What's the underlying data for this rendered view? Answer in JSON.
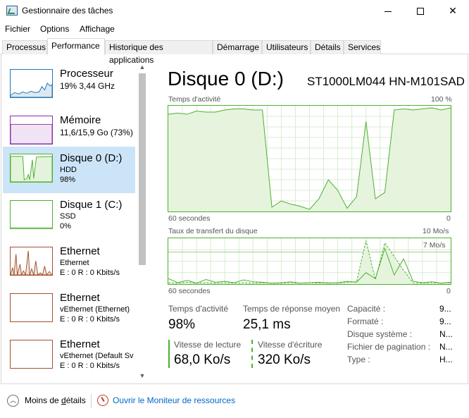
{
  "window": {
    "title": "Gestionnaire des tâches",
    "minimize_glyph": "",
    "maximize_glyph": "",
    "close_glyph": "✕"
  },
  "menu": [
    "Fichier",
    "Options",
    "Affichage"
  ],
  "tabs": [
    "Processus",
    "Performance",
    "Historique des applications",
    "Démarrage",
    "Utilisateurs",
    "Détails",
    "Services"
  ],
  "active_tab": "Performance",
  "sidebar": {
    "items": [
      {
        "name": "Processeur",
        "line1": "19% 3,44 GHz",
        "line2": "",
        "color": "#1f77b4",
        "level": 0.19
      },
      {
        "name": "Mémoire",
        "line1": "11,6/15,9 Go (73%)",
        "line2": "",
        "color": "#8b2fa8",
        "level": 0.73
      },
      {
        "name": "Disque 0 (D:)",
        "line1": "HDD",
        "line2": "98%",
        "color": "#4caf2f",
        "level": 0.98
      },
      {
        "name": "Disque 1 (C:)",
        "line1": "SSD",
        "line2": "0%",
        "color": "#4caf2f",
        "level": 0.0
      },
      {
        "name": "Ethernet",
        "line1": "Ethernet",
        "line2": "E : 0 R : 0 Kbits/s",
        "color": "#a0522d",
        "level": 0.0
      },
      {
        "name": "Ethernet",
        "line1": "vEthernet (Ethernet)",
        "line2": "E : 0 R : 0 Kbits/s",
        "color": "#a0522d",
        "level": 0.0
      },
      {
        "name": "Ethernet",
        "line1": "vEthernet (Default Sv",
        "line2": "E : 0 R : 0 Kbits/s",
        "color": "#a0522d",
        "level": 0.0
      }
    ]
  },
  "main": {
    "title": "Disque 0 (D:)",
    "model": "ST1000LM044 HN-M101SAD",
    "activity_chart": {
      "label": "Temps d'activité",
      "max_label": "100 %",
      "time_label": "60 secondes",
      "min_label": "0"
    },
    "transfer_chart": {
      "label": "Taux de transfert du disque",
      "max_label": "10 Mo/s",
      "mid_label": "7 Mo/s",
      "time_label": "60 secondes",
      "min_label": "0"
    },
    "stats": {
      "activity_label": "Temps d'activité",
      "activity_value": "98%",
      "response_label": "Temps de réponse moyen",
      "response_value": "25,1 ms",
      "read_label": "Vitesse de lecture",
      "read_value": "68,0 Ko/s",
      "write_label": "Vitesse d'écriture",
      "write_value": "320 Ko/s"
    },
    "properties": [
      {
        "label": "Capacité :",
        "value": "9..."
      },
      {
        "label": "Formaté :",
        "value": "9..."
      },
      {
        "label": "Disque système :",
        "value": "N..."
      },
      {
        "label": "Fichier de pagination :",
        "value": "N..."
      },
      {
        "label": "Type :",
        "value": "H..."
      }
    ]
  },
  "chart_data": [
    {
      "type": "area",
      "title": "Temps d'activité",
      "ylabel": "",
      "xlabel": "60 secondes",
      "ylim": [
        0,
        100
      ],
      "x": [
        0,
        2,
        4,
        6,
        8,
        10,
        12,
        14,
        16,
        18,
        20,
        22,
        24,
        26,
        28,
        30,
        32,
        34,
        36,
        38,
        40,
        42,
        44,
        46,
        48,
        50,
        52,
        54,
        56,
        58,
        60
      ],
      "series": [
        {
          "values": [
            92,
            93,
            92,
            95,
            94,
            94,
            96,
            97,
            97,
            96,
            96,
            4,
            10,
            7,
            5,
            2,
            12,
            30,
            20,
            3,
            14,
            85,
            12,
            18,
            96,
            97,
            96,
            97,
            98,
            96,
            98
          ]
        }
      ]
    },
    {
      "type": "area",
      "title": "Taux de transfert du disque",
      "ylabel": "",
      "xlabel": "60 secondes",
      "ylim": [
        0,
        10
      ],
      "x": [
        0,
        2,
        4,
        6,
        8,
        10,
        12,
        14,
        16,
        18,
        20,
        22,
        24,
        26,
        28,
        30,
        32,
        34,
        36,
        38,
        40,
        42,
        44,
        46,
        48,
        50,
        52,
        54,
        56,
        58,
        60
      ],
      "series": [
        {
          "name": "Vitesse de lecture",
          "values": [
            1.2,
            0.3,
            0.8,
            0.2,
            1.0,
            0.4,
            0.6,
            0.3,
            0.9,
            0.5,
            0.4,
            0.2,
            0.3,
            0.5,
            0.2,
            0.3,
            0.4,
            0.2,
            0.3,
            0.6,
            0.4,
            2.5,
            1.2,
            7.8,
            2.0,
            5.5,
            0.6,
            0.3,
            0.5,
            0.2,
            0.4
          ]
        },
        {
          "name": "Vitesse d'écriture",
          "values": [
            0.3,
            0.2,
            0.4,
            0.2,
            0.3,
            0.2,
            0.3,
            0.2,
            0.3,
            0.2,
            0.3,
            0.2,
            0.2,
            0.3,
            0.2,
            0.3,
            0.2,
            0.3,
            0.2,
            0.4,
            0.5,
            9.5,
            1.0,
            9.0,
            6.0,
            3.0,
            0.3,
            0.2,
            0.3,
            0.2,
            0.3
          ]
        }
      ]
    }
  ]
}
